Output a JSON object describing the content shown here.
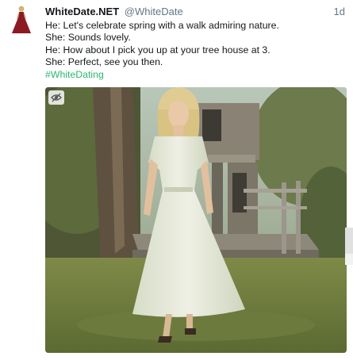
{
  "tweet": {
    "display_name": "WhiteDate.NET",
    "handle": "@WhiteDate",
    "time_ago": "1d",
    "lines": [
      "He: Let's celebrate spring with a walk admiring nature.",
      "She: Sounds lovely.",
      "He: How about I pick you up at your tree house at 3.",
      "She: Perfect, see you then."
    ],
    "hashtag": "#WhiteDating",
    "avatar_icon": "dress-avatar-icon",
    "media_toggle_icon": "eye-slash-icon",
    "colors": {
      "hashtag": "#2bb673",
      "name": "#14171a",
      "muted": "#657786",
      "avatar_dress": "#8b1a22"
    }
  }
}
